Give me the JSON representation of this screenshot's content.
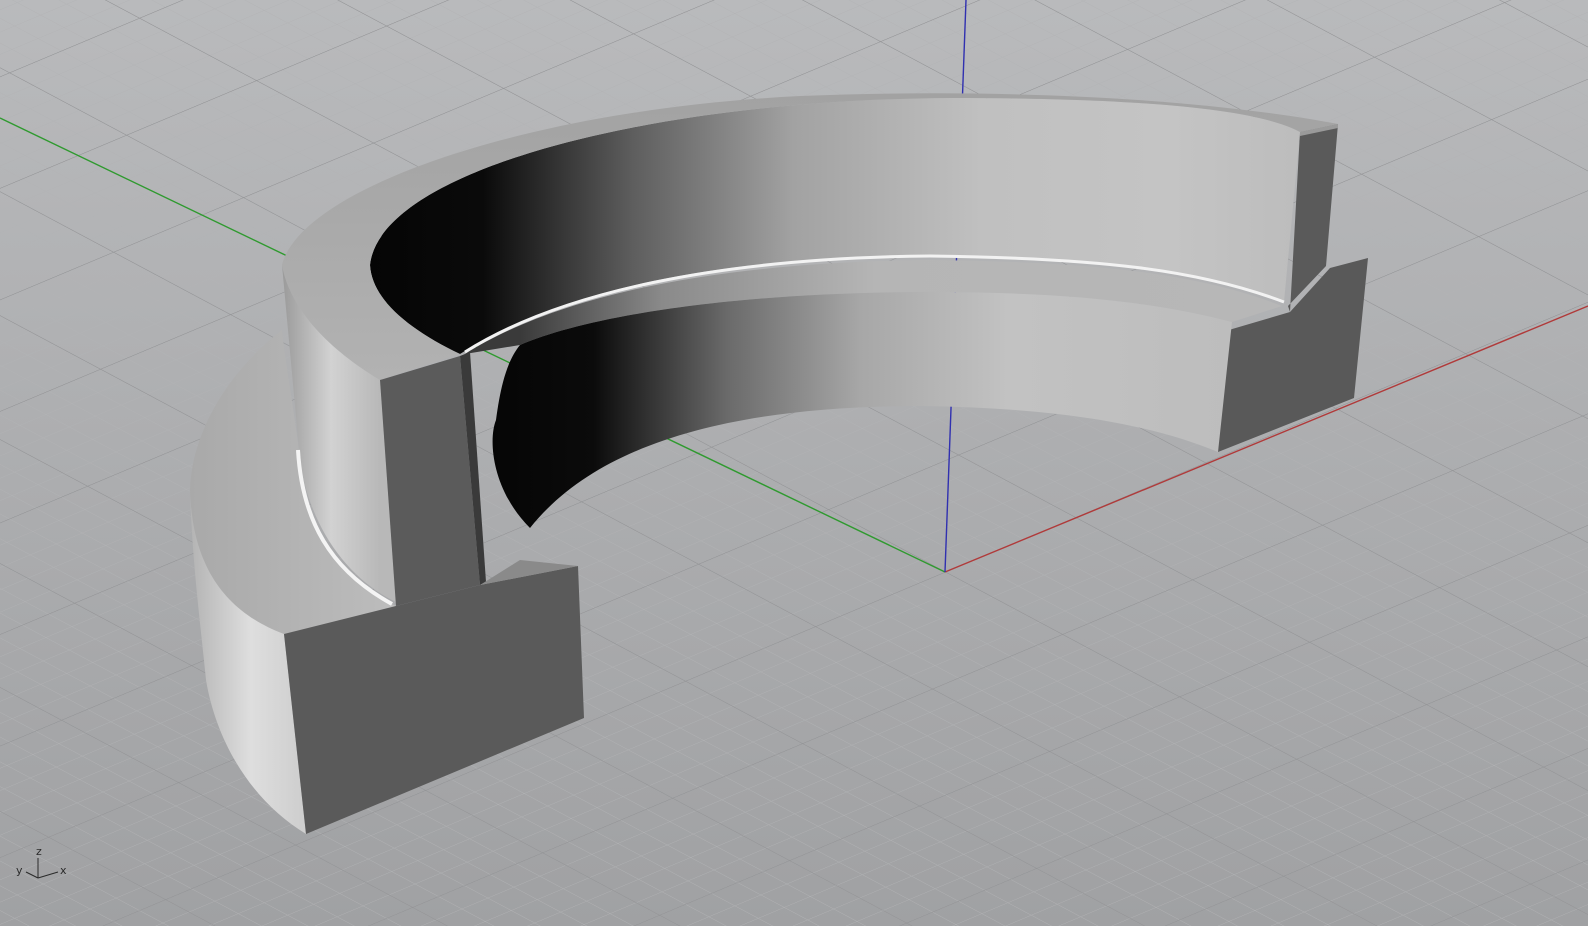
{
  "viewport": {
    "projection": "perspective",
    "display_mode": "shaded",
    "background_color": "#a3a4a6",
    "grid_minor_color": "#b4b5b7",
    "grid_major_color": "#8f9092",
    "object_color": "#8c8c8c"
  },
  "world_axes": {
    "x_color": "#b03a3a",
    "y_color": "#2f9a2f",
    "z_color": "#3030b0"
  },
  "axis_indicator": {
    "x_label": "x",
    "y_label": "y",
    "z_label": "z"
  },
  "model": {
    "shape": "partial-ring-with-t-section-profile"
  }
}
